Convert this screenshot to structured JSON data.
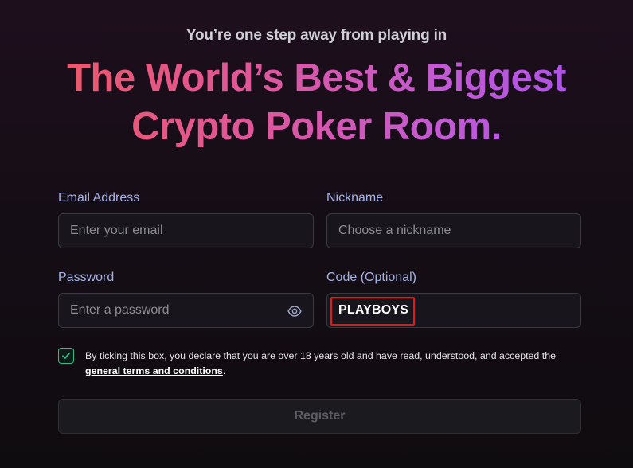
{
  "header": {
    "subtitle": "You’re one step away from playing in",
    "headline_line1": "The World’s Best & Biggest",
    "headline_line2": "Crypto Poker Room."
  },
  "form": {
    "email": {
      "label": "Email Address",
      "placeholder": "Enter your email",
      "value": ""
    },
    "nickname": {
      "label": "Nickname",
      "placeholder": "Choose a nickname",
      "value": ""
    },
    "password": {
      "label": "Password",
      "placeholder": "Enter a password",
      "value": "",
      "icon": "eye-icon"
    },
    "code": {
      "label": "Code (Optional)",
      "placeholder": "",
      "value": "PLAYBOYS"
    },
    "terms": {
      "checked": true,
      "text": "By ticking this box, you declare that you are over 18 years old and have read, understood, and accepted the",
      "link_text": "general terms and conditions",
      "suffix": "."
    },
    "register_label": "Register"
  },
  "colors": {
    "gradient_start": "#f05a5c",
    "gradient_end": "#a54df2",
    "label": "#a7b3e8",
    "checkbox_accent": "#2fbf8f",
    "highlight_border": "#e01a1a"
  }
}
